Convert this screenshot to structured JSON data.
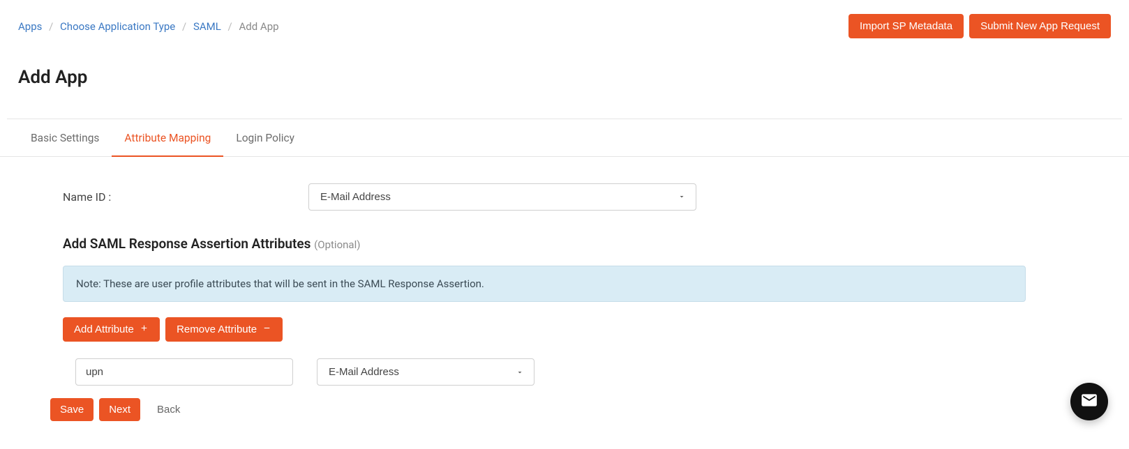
{
  "breadcrumb": {
    "apps": "Apps",
    "choose_type": "Choose Application Type",
    "saml": "SAML",
    "add_app": "Add App"
  },
  "top_actions": {
    "import_metadata": "Import SP Metadata",
    "submit_request": "Submit New App Request"
  },
  "page_title": "Add App",
  "tabs": {
    "basic": "Basic Settings",
    "attribute": "Attribute Mapping",
    "login": "Login Policy"
  },
  "form": {
    "name_id_label": "Name ID :",
    "name_id_value": "E-Mail Address"
  },
  "section": {
    "heading": "Add SAML Response Assertion Attributes ",
    "optional": "(Optional)",
    "note": "Note: These are user profile attributes that will be sent in the SAML Response Assertion."
  },
  "buttons": {
    "add_attribute": "Add Attribute",
    "remove_attribute": "Remove Attribute",
    "save": "Save",
    "next": "Next",
    "back": "Back"
  },
  "attribute_rows": [
    {
      "key": "upn",
      "value": "E-Mail Address"
    }
  ],
  "icons": {
    "chat": "chat-icon"
  }
}
